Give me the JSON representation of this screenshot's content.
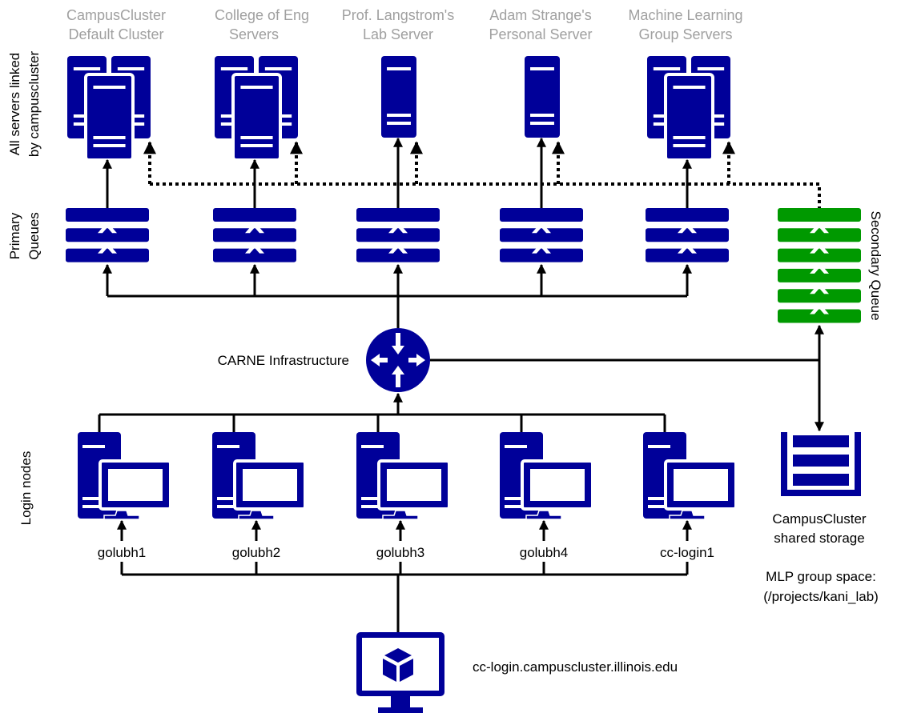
{
  "colors": {
    "primary": "#000099",
    "secondary": "#009900",
    "server_label": "#a0a0a0"
  },
  "servers": [
    {
      "line1": "CampusCluster",
      "line2": "Default Cluster",
      "icon": "server-cluster-icon"
    },
    {
      "line1": "College of Eng",
      "line2": "Servers",
      "icon": "server-cluster-icon"
    },
    {
      "line1": "Prof. Langstrom's",
      "line2": "Lab Server",
      "icon": "server-icon"
    },
    {
      "line1": "Adam Strange's",
      "line2": "Personal Server",
      "icon": "server-icon"
    },
    {
      "line1": "Machine Learning",
      "line2": "Group Servers",
      "icon": "server-cluster-icon"
    }
  ],
  "side_labels": {
    "servers": [
      "All servers linked",
      "by campuscluster"
    ],
    "queues": [
      "Primary",
      "Queues"
    ],
    "login": "Login nodes",
    "secondary_queue": "Secondary Queue"
  },
  "router_label": "CARNE Infrastructure",
  "login_nodes": [
    "golubh1",
    "golubh2",
    "golubh3",
    "golubh4",
    "cc-login1"
  ],
  "storage": {
    "line1": "CampusCluster",
    "line2": "shared storage",
    "group_line1": "MLP group space:",
    "group_line2": "(/projects/kani_lab)"
  },
  "entry": {
    "label": "cc-login.campuscluster.illinois.edu"
  }
}
